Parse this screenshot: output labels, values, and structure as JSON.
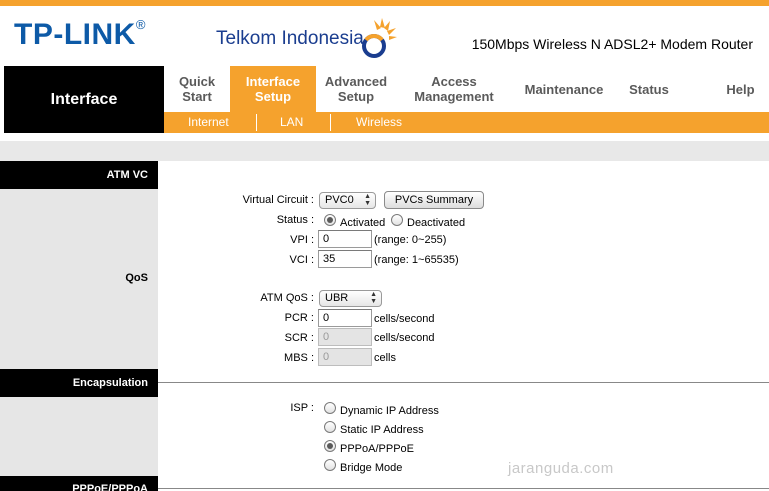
{
  "header": {
    "brand": "TP-LINK",
    "brand_mark": "®",
    "partner": "Telkom Indonesia",
    "model": "150Mbps Wireless N ADSL2+ Modem Router"
  },
  "nav": {
    "section_label": "Interface",
    "items": [
      {
        "line1": "Quick",
        "line2": "Start"
      },
      {
        "line1": "Interface",
        "line2": "Setup"
      },
      {
        "line1": "Advanced",
        "line2": "Setup"
      },
      {
        "line1": "Access",
        "line2": "Management"
      },
      {
        "line1": "Maintenance",
        "line2": ""
      },
      {
        "line1": "Status",
        "line2": ""
      },
      {
        "line1": "Help",
        "line2": ""
      }
    ],
    "sub_items": [
      "Internet",
      "LAN",
      "Wireless"
    ]
  },
  "sections": {
    "atm_vc": "ATM VC",
    "qos": "QoS",
    "encapsulation": "Encapsulation",
    "pppoe": "PPPoE/PPPoA"
  },
  "atm": {
    "virtual_circuit_label": "Virtual Circuit :",
    "virtual_circuit_value": "PVC0",
    "pvcs_summary_button": "PVCs Summary",
    "status_label": "Status :",
    "status_activated": "Activated",
    "status_deactivated": "Deactivated",
    "vpi_label": "VPI :",
    "vpi_value": "0",
    "vpi_range": "(range: 0~255)",
    "vci_label": "VCI :",
    "vci_value": "35",
    "vci_range": "(range: 1~65535)"
  },
  "qos": {
    "atm_qos_label": "ATM QoS :",
    "atm_qos_value": "UBR",
    "pcr_label": "PCR :",
    "pcr_value": "0",
    "pcr_unit": "cells/second",
    "scr_label": "SCR :",
    "scr_value": "0",
    "scr_unit": "cells/second",
    "mbs_label": "MBS :",
    "mbs_value": "0",
    "mbs_unit": "cells"
  },
  "encapsulation": {
    "isp_label": "ISP :",
    "options": [
      "Dynamic IP Address",
      "Static IP Address",
      "PPPoA/PPPoE",
      "Bridge Mode"
    ],
    "selected": "PPPoA/PPPoE"
  },
  "watermark": "jaranguda.com",
  "colors": {
    "accent": "#f5a22d",
    "brand_blue": "#0d5aa7"
  }
}
